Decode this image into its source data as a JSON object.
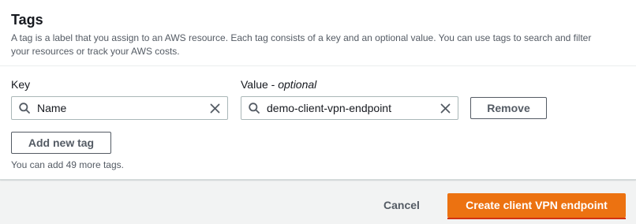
{
  "tags_panel": {
    "title": "Tags",
    "description": "A tag is a label that you assign to an AWS resource. Each tag consists of a key and an optional value. You can use tags to search and filter your resources or track your AWS costs.",
    "key_label": "Key",
    "value_label": "Value",
    "value_label_suffix": "optional",
    "tag_row": {
      "key": "Name",
      "value": "demo-client-vpn-endpoint",
      "remove_label": "Remove"
    },
    "add_new_tag_label": "Add new tag",
    "remaining_hint": "You can add 49 more tags."
  },
  "footer": {
    "cancel_label": "Cancel",
    "submit_label": "Create client VPN endpoint"
  },
  "colors": {
    "primary": "#ec7211",
    "focus_underline": "#d13212",
    "text_secondary": "#545b64",
    "border": "#aab7b8"
  },
  "icons": {
    "search": "search-icon",
    "clear": "close-icon"
  }
}
